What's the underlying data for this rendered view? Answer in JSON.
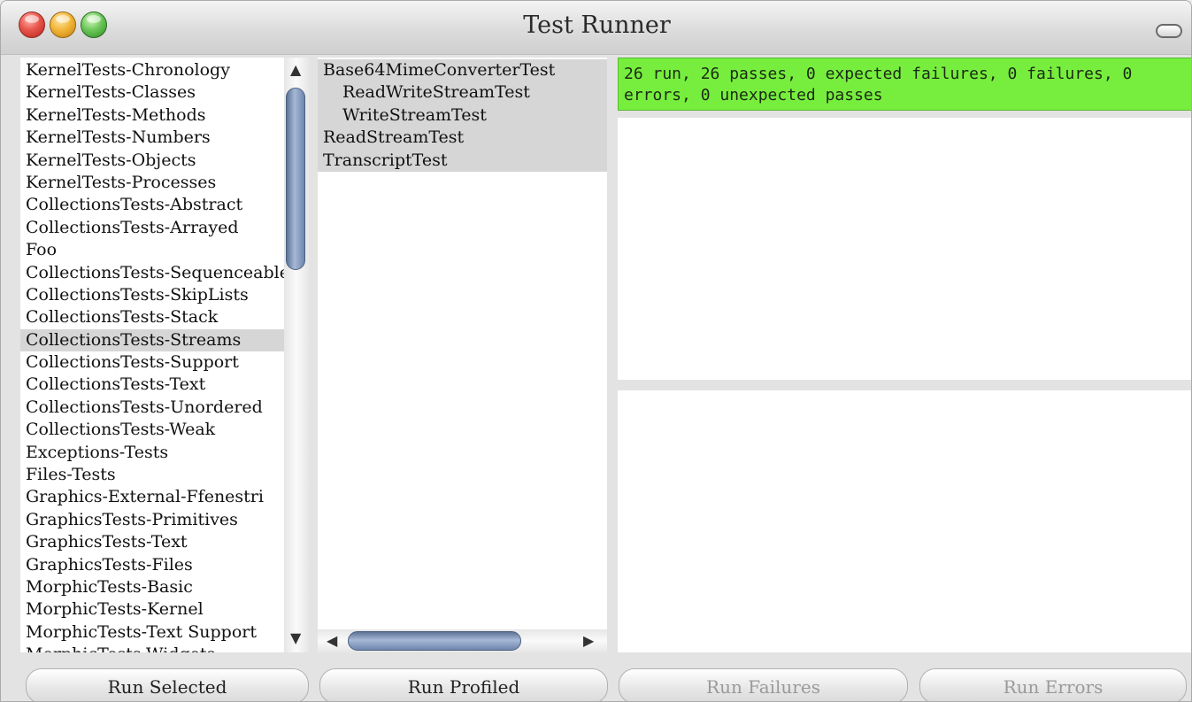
{
  "window": {
    "title": "Test Runner"
  },
  "categories": {
    "items": [
      "KernelTests-Chronology",
      "KernelTests-Classes",
      "KernelTests-Methods",
      "KernelTests-Numbers",
      "KernelTests-Objects",
      "KernelTests-Processes",
      "CollectionsTests-Abstract",
      "CollectionsTests-Arrayed",
      "Foo",
      "CollectionsTests-Sequenceable",
      "CollectionsTests-SkipLists",
      "CollectionsTests-Stack",
      "CollectionsTests-Streams",
      "CollectionsTests-Support",
      "CollectionsTests-Text",
      "CollectionsTests-Unordered",
      "CollectionsTests-Weak",
      "Exceptions-Tests",
      "Files-Tests",
      "Graphics-External-Ffenestri",
      "GraphicsTests-Primitives",
      "GraphicsTests-Text",
      "GraphicsTests-Files",
      "MorphicTests-Basic",
      "MorphicTests-Kernel",
      "MorphicTests-Text Support",
      "MorphicTests-Widgets"
    ],
    "selected": "CollectionsTests-Streams"
  },
  "classes": {
    "items": [
      "Base64MimeConverterTest",
      "ReadWriteStreamTest",
      "WriteStreamTest",
      "ReadStreamTest",
      "TranscriptTest"
    ]
  },
  "result": {
    "summary": "26 run, 26 passes, 0 expected failures, 0 failures, 0 errors, 0 unexpected passes",
    "color": "#77ee3e"
  },
  "buttons": {
    "run_selected": "Run Selected",
    "run_profiled": "Run Profiled",
    "run_failures": "Run Failures",
    "run_errors": "Run Errors"
  }
}
